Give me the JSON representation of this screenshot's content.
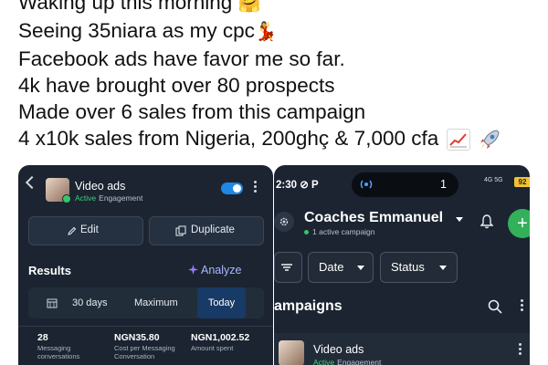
{
  "caption": {
    "lines": [
      "Waking up this morning",
      "Seeing 35niara as my cpc",
      "Facebook ads have favor me so far.",
      "4k have brought over 80 prospects",
      "Made over 6 sales from this campaign",
      "4 x10k sales from Nigeria, 200ghç & 7,000 cfa"
    ]
  },
  "left_screen": {
    "ad": {
      "title": "Video ads",
      "status_active": "Active",
      "status_type": "Engagement"
    },
    "buttons": {
      "edit": "Edit",
      "duplicate": "Duplicate"
    },
    "results_title": "Results",
    "analyze": "Analyze",
    "date_range": {
      "options": [
        "30 days",
        "Maximum",
        "Today"
      ],
      "selected": "Today"
    },
    "metrics": [
      {
        "value": "28",
        "label": "Messaging conversations"
      },
      {
        "value": "NGN35.80",
        "label": "Cost per Messaging Conversation"
      },
      {
        "value": "NGN1,002.52",
        "label": "Amount spent"
      }
    ]
  },
  "right_screen": {
    "status_bar": {
      "time": "2:30",
      "island_count": "1",
      "battery": "92"
    },
    "account": {
      "name": "Coaches Emmanuel",
      "sub": "1 active campaign"
    },
    "filters": {
      "date": "Date",
      "status": "Status"
    },
    "section_title": "ampaigns",
    "campaign": {
      "name": "Video ads",
      "status_active": "Active",
      "status_type": "Engagement"
    }
  },
  "colors": {
    "accent_blue": "#1e88e5",
    "active_green": "#3fcf7a",
    "fab_green": "#33b15a",
    "screen_bg": "#1b2430"
  },
  "icons": [
    "hugging-face-emoji",
    "dancer-emoji",
    "chart-increasing-emoji",
    "rocket-emoji",
    "back-chevron-icon",
    "pencil-icon",
    "duplicate-icon",
    "sparkle-icon",
    "calendar-icon",
    "gear-icon",
    "bell-icon",
    "plus-icon",
    "filter-icon",
    "search-icon",
    "more-vertical-icon"
  ]
}
